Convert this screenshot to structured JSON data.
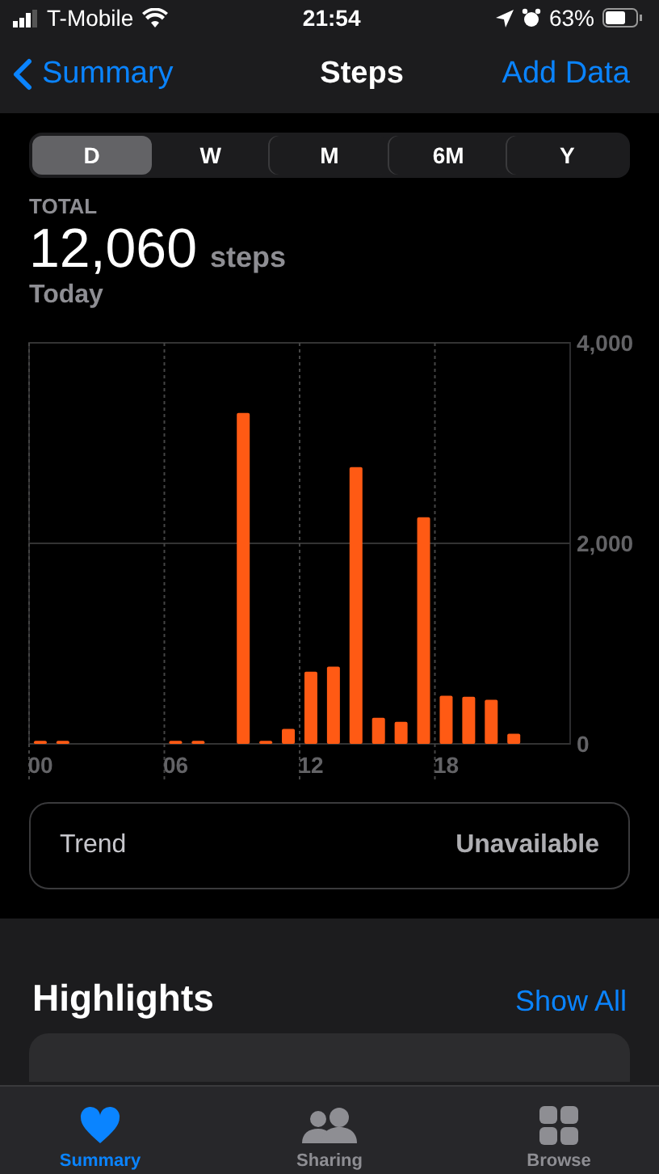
{
  "status_bar": {
    "carrier": "T-Mobile",
    "time": "21:54",
    "battery": "63%"
  },
  "nav": {
    "back": "Summary",
    "title": "Steps",
    "action": "Add Data"
  },
  "segments": [
    {
      "label": "D",
      "selected": true
    },
    {
      "label": "W",
      "selected": false
    },
    {
      "label": "M",
      "selected": false
    },
    {
      "label": "6M",
      "selected": false
    },
    {
      "label": "Y",
      "selected": false
    }
  ],
  "summary": {
    "label": "TOTAL",
    "value": "12,060",
    "unit": "steps",
    "period": "Today"
  },
  "chart_data": {
    "type": "bar",
    "x": [
      0,
      1,
      6,
      7,
      9,
      10,
      11,
      12,
      13,
      14,
      15,
      16,
      17,
      18,
      19,
      20,
      21
    ],
    "series": [
      {
        "color": "#ff5a14",
        "values": [
          30,
          30,
          30,
          30,
          3300,
          30,
          150,
          720,
          770,
          2760,
          260,
          220,
          2260,
          480,
          470,
          440,
          100
        ]
      }
    ],
    "xlim": [
      -0.5,
      23.5
    ],
    "ylim": [
      0,
      4000
    ],
    "yticks": [
      {
        "value": 0,
        "label": "0"
      },
      {
        "value": 2000,
        "label": "2,000"
      },
      {
        "value": 4000,
        "label": "4,000"
      }
    ],
    "xticks": [
      {
        "value": 0,
        "label": "00"
      },
      {
        "value": 6,
        "label": "06"
      },
      {
        "value": 12,
        "label": "12"
      },
      {
        "value": 18,
        "label": "18"
      }
    ]
  },
  "trend": {
    "label": "Trend",
    "value": "Unavailable"
  },
  "highlights": {
    "title": "Highlights",
    "action": "Show All"
  },
  "tab_bar": [
    {
      "label": "Summary",
      "kind": "heart",
      "selected": true
    },
    {
      "label": "Sharing",
      "kind": "people",
      "selected": false
    },
    {
      "label": "Browse",
      "kind": "grid",
      "selected": false
    }
  ]
}
